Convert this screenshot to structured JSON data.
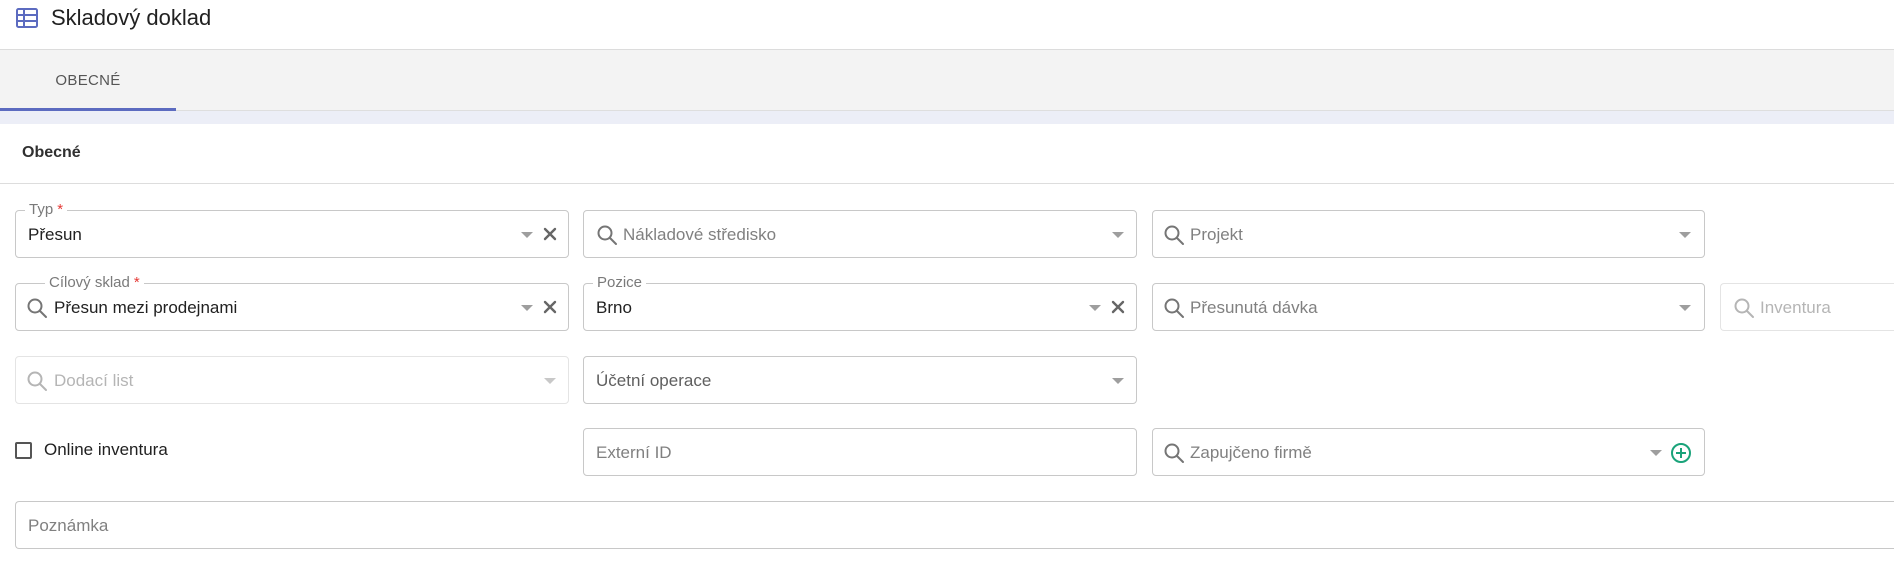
{
  "header": {
    "title": "Skladový doklad",
    "icon": "table-icon"
  },
  "tabs": [
    {
      "label": "OBECNÉ",
      "active": true
    }
  ],
  "section": {
    "title": "Obecné"
  },
  "fields": {
    "typ": {
      "label": "Typ",
      "required_mark": "*",
      "value": "Přesun"
    },
    "nakladove_stredisko": {
      "placeholder": "Nákladové středisko"
    },
    "projekt": {
      "placeholder": "Projekt"
    },
    "cilovy_sklad": {
      "label": "Cílový sklad",
      "required_mark": "*",
      "value": "Přesun mezi prodejnami"
    },
    "pozice": {
      "label": "Pozice",
      "value": "Brno"
    },
    "presunuta_davka": {
      "placeholder": "Přesunutá dávka"
    },
    "inventura": {
      "placeholder": "Inventura"
    },
    "dodaci_list": {
      "placeholder": "Dodací list"
    },
    "ucetni_operace": {
      "placeholder": "Účetní operace"
    },
    "online_inventura": {
      "label": "Online inventura",
      "checked": false
    },
    "externi_id": {
      "placeholder": "Externí ID"
    },
    "zapujceno_firme": {
      "placeholder": "Zapujčeno firmě"
    },
    "poznamka": {
      "placeholder": "Poznámka"
    }
  },
  "colors": {
    "accent": "#5c6bc0",
    "required": "#e53935",
    "add": "#1aa37a"
  }
}
